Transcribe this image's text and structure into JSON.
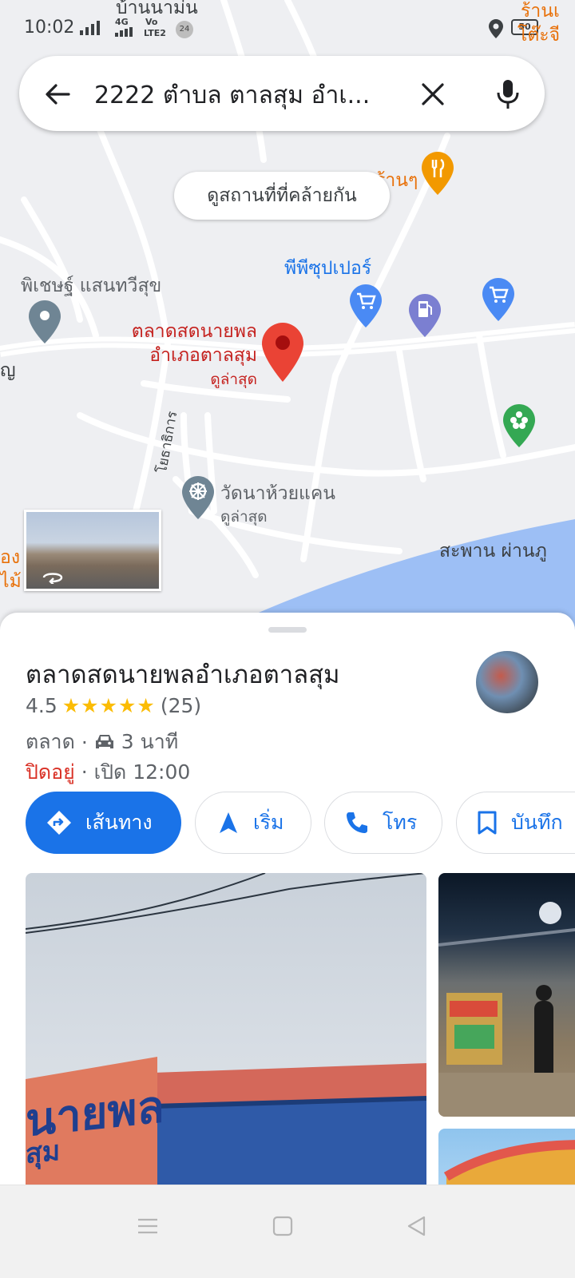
{
  "status_bar": {
    "time": "10:02",
    "net_4g": "4G",
    "volte_top": "Vo",
    "volte_bottom": "LTE2",
    "notification_count": "24",
    "battery": "50"
  },
  "search": {
    "query": "2222 ตำบล ตาลสุม อำเ...",
    "back_icon": "arrow-back-icon",
    "clear_icon": "close-icon",
    "mic_icon": "mic-icon"
  },
  "map": {
    "similar_places_chip": "ดูสถานที่ที่คล้ายกัน",
    "labels": {
      "top_village": "บ้านนาม่น",
      "top_right_shop_1": "ร้านเ",
      "top_right_shop_2": "โต๊ะจี",
      "restaurant": "ร้านๆ",
      "supermarket": "พีพีซุปเปอร์",
      "pichet": "พิเชษฐ์ แสนทวีสุข",
      "selected_place_line1": "ตลาดสดนายพล",
      "selected_place_line2": "อำเภอตาลสุม",
      "selected_place_recent": "ดูล่าสุด",
      "road_name": "โยธาธิการ",
      "temple": "วัดนาห้วยแคน",
      "temple_recent": "ดูล่าสุด",
      "bridge": "สะพาน ผ่านภู",
      "left_edge_1": "ญ",
      "left_edge_2": "อง",
      "left_edge_3": "ไม้"
    },
    "colors": {
      "water": "#9dbff5",
      "selected_pin": "#ea4335",
      "shopping_pin": "#4a8af4",
      "fuel_pin": "#7b7fd1",
      "park_pin": "#34a853",
      "grey_pin": "#6f8594",
      "food_pin": "#f29900"
    }
  },
  "place": {
    "name": "ตลาดสดนายพลอำเภอตาลสุม",
    "rating": "4.5",
    "stars": "★★★★★",
    "rating_value": 4.5,
    "review_count": "(25)",
    "category": "ตลาด",
    "drive_time": "3 นาที",
    "hours_status": "ปิดอยู่",
    "hours_next": "· เปิด 12:00",
    "actions": {
      "directions": "เส้นทาง",
      "start": "เริ่ม",
      "call": "โทร",
      "save": "บันทึก"
    },
    "photo_sign_line1": "นายพล",
    "photo_sign_line2": "สุม"
  },
  "nav_bar": {
    "menu_icon": "menu-icon",
    "home_icon": "home-icon",
    "back_icon": "back-triangle-icon"
  }
}
